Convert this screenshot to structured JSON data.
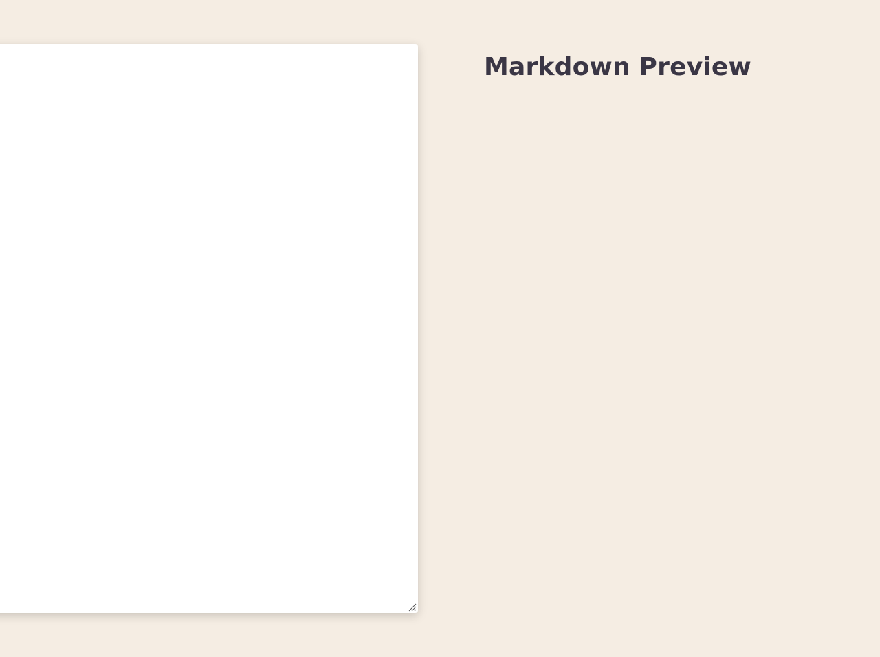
{
  "editor": {
    "value": "",
    "placeholder": ""
  },
  "preview": {
    "title": "Markdown Preview",
    "content": ""
  },
  "colors": {
    "background": "#f5ede3",
    "editor_bg": "#ffffff",
    "title_text": "#3a3645"
  },
  "icons": {
    "resize": "resize-grip-icon"
  }
}
